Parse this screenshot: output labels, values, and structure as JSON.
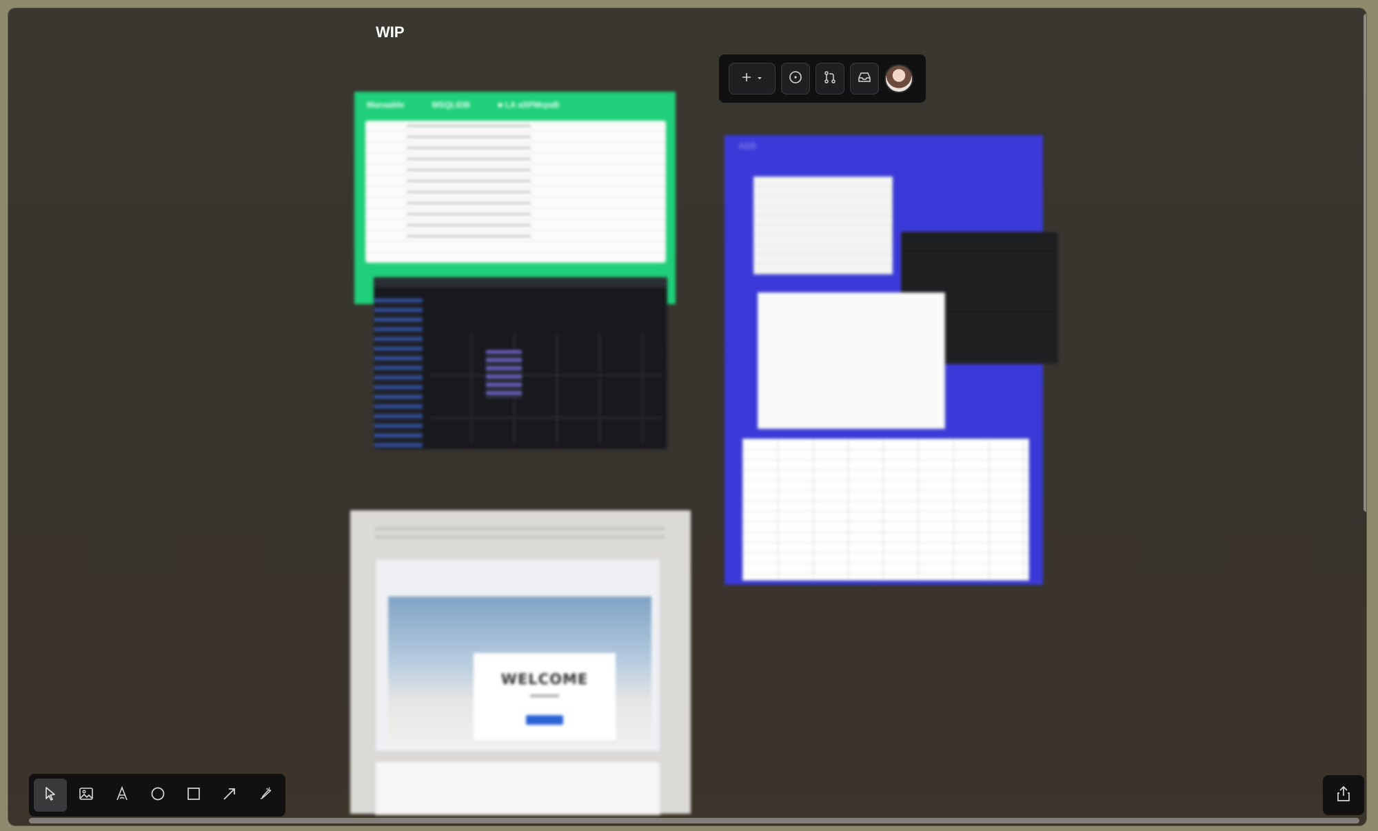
{
  "board": {
    "title": "WIP"
  },
  "frames": {
    "green": {
      "header_items": [
        "Manaable",
        "MSQLIDB",
        "■ LA  aSPMrpaB"
      ]
    },
    "blue": {
      "label": "ABB"
    },
    "gray": {
      "welcome_text": "WELCOME"
    }
  },
  "top_toolbar": {
    "buttons": [
      "add-icon",
      "chevron-down-icon",
      "circle-dot-icon",
      "git-pull-request-icon",
      "inbox-icon",
      "avatar"
    ]
  },
  "bottom_toolbar": {
    "tools": [
      "pointer-icon",
      "image-icon",
      "text-icon",
      "circle-icon",
      "rectangle-icon",
      "arrow-icon",
      "brush-icon"
    ],
    "active": "pointer-icon"
  },
  "colors": {
    "canvas": "#37332d",
    "green_frame": "#1fcf79",
    "blue_frame": "#3b3ad8",
    "toolbar": "#111112"
  }
}
